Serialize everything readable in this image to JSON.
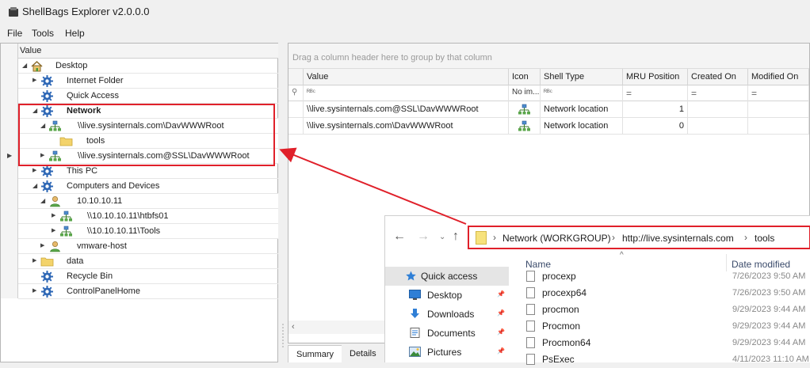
{
  "app": {
    "title": "ShellBags Explorer v2.0.0.0"
  },
  "menu": [
    "File",
    "Tools",
    "Help"
  ],
  "tree": {
    "header": "Value",
    "rows": [
      {
        "label": "Desktop",
        "icon": "home-icon",
        "expander": "collapse"
      },
      {
        "label": "Internet Folder",
        "icon": "gear-icon",
        "expander": "expand"
      },
      {
        "label": "Quick Access",
        "icon": "gear-icon",
        "expander": "none"
      },
      {
        "label": "Network",
        "icon": "gear-icon",
        "expander": "collapse",
        "selected": true
      },
      {
        "label": "\\\\live.sysinternals.com\\DavWWWRoot",
        "icon": "network-icon",
        "expander": "collapse"
      },
      {
        "label": "tools",
        "icon": "folder-icon",
        "expander": "none"
      },
      {
        "label": "\\\\live.sysinternals.com@SSL\\DavWWWRoot",
        "icon": "network-icon",
        "expander": "expand"
      },
      {
        "label": "This PC",
        "icon": "gear-icon",
        "expander": "expand"
      },
      {
        "label": "Computers and Devices",
        "icon": "gear-icon",
        "expander": "collapse"
      },
      {
        "label": "10.10.10.11",
        "icon": "user-icon",
        "expander": "collapse"
      },
      {
        "label": "\\\\10.10.10.11\\htbfs01",
        "icon": "network-icon",
        "expander": "expand"
      },
      {
        "label": "\\\\10.10.10.11\\Tools",
        "icon": "network-icon",
        "expander": "expand"
      },
      {
        "label": "vmware-host",
        "icon": "user-icon",
        "expander": "expand"
      },
      {
        "label": "data",
        "icon": "folder-icon",
        "expander": "expand"
      },
      {
        "label": "Recycle Bin",
        "icon": "gear-icon",
        "expander": "none"
      },
      {
        "label": "ControlPanelHome",
        "icon": "gear-icon",
        "expander": "expand"
      }
    ]
  },
  "grid": {
    "group_hint": "Drag a column header here to group by that column",
    "columns": [
      "Value",
      "Icon",
      "Shell Type",
      "MRU Position",
      "Created On",
      "Modified On"
    ],
    "filter_row": [
      "ᴿᴮᶜ",
      "No im...",
      "ᴿᴮᶜ",
      "=",
      "=",
      "="
    ],
    "rows": [
      {
        "value": "\\\\live.sysinternals.com@SSL\\DavWWWRoot",
        "shell_type": "Network location",
        "mru": "1"
      },
      {
        "value": "\\\\live.sysinternals.com\\DavWWWRoot",
        "shell_type": "Network location",
        "mru": "0"
      }
    ]
  },
  "tabs": [
    "Summary",
    "Details"
  ],
  "explorer": {
    "breadcrumb": [
      "Network (WORKGROUP)",
      "http://live.sysinternals.com",
      "tools"
    ],
    "list_header": {
      "name": "Name",
      "date": "Date modified"
    },
    "nav": [
      {
        "label": "Quick access",
        "icon": "star-icon",
        "selected": true
      },
      {
        "label": "Desktop",
        "icon": "desktop-icon"
      },
      {
        "label": "Downloads",
        "icon": "download-icon"
      },
      {
        "label": "Documents",
        "icon": "documents-icon"
      },
      {
        "label": "Pictures",
        "icon": "pictures-icon"
      }
    ],
    "files": [
      {
        "name": "procexp",
        "date": "7/26/2023 9:50 AM"
      },
      {
        "name": "procexp64",
        "date": "7/26/2023 9:50 AM"
      },
      {
        "name": "procmon",
        "date": "9/29/2023 9:44 AM"
      },
      {
        "name": "Procmon",
        "date": "9/29/2023 9:44 AM"
      },
      {
        "name": "Procmon64",
        "date": "9/29/2023 9:44 AM"
      },
      {
        "name": "PsExec",
        "date": "4/11/2023 11:10 AM"
      }
    ]
  },
  "colors": {
    "annotation_red": "#e0202a",
    "selection": "#cde8ff"
  }
}
